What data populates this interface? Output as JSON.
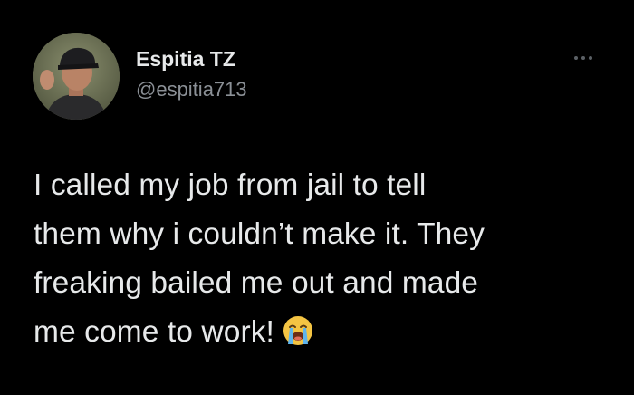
{
  "tweet": {
    "author": {
      "display_name": "Espitia TZ",
      "handle": "@espitia713"
    },
    "text_lines": [
      "I called my job from jail to tell",
      "them why i couldn’t make it. They",
      "freaking bailed me out and made",
      "me come to work!"
    ],
    "emoji": "loudly-crying-face-icon",
    "more_icon": "more-options-icon"
  },
  "colors": {
    "background": "#000000",
    "text": "#e7e9ea",
    "secondary_text": "#8b9096"
  }
}
